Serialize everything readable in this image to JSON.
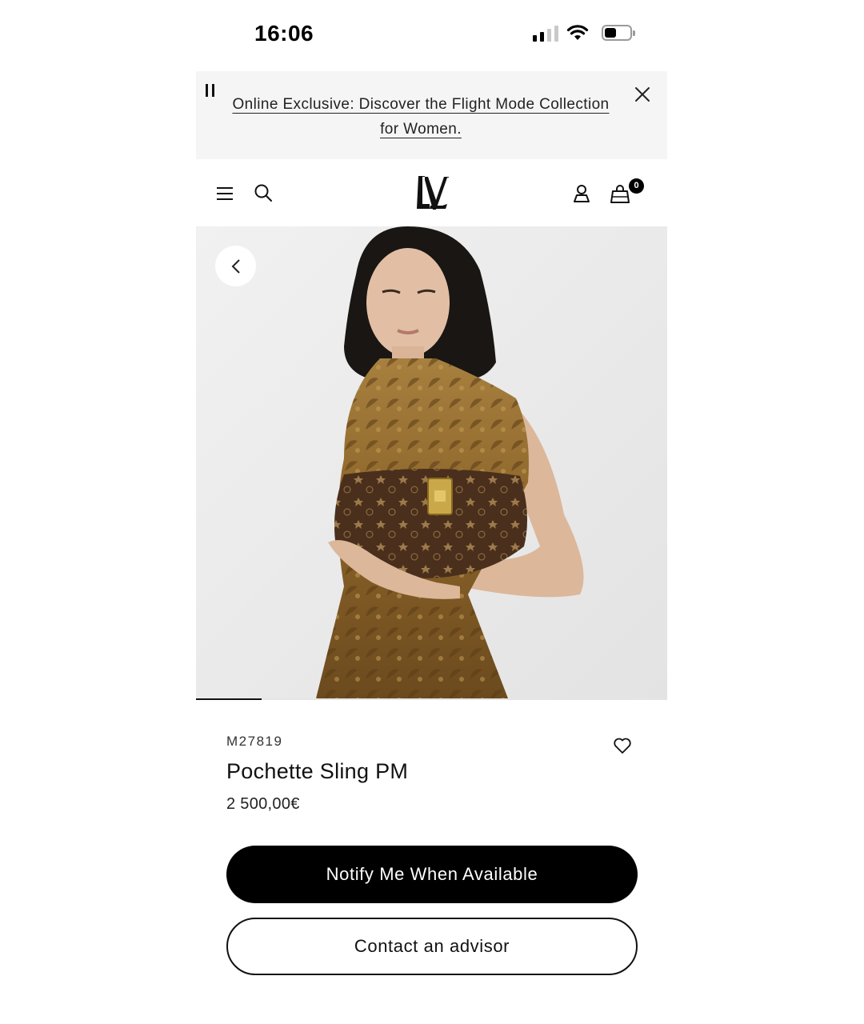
{
  "status_bar": {
    "time": "16:06"
  },
  "promo": {
    "text": "Online Exclusive: Discover the Flight Mode Collection for Women."
  },
  "nav": {
    "bag_count": "0",
    "icons": [
      "menu-icon",
      "search-icon",
      "lv-logo",
      "account-icon",
      "shopping-bag-icon"
    ]
  },
  "gallery": {
    "progress": 0.14
  },
  "product": {
    "sku": "M27819",
    "name": "Pochette Sling PM",
    "price": "2 500,00€"
  },
  "actions": {
    "notify_label": "Notify Me When Available",
    "advisor_label": "Contact an advisor"
  },
  "colors": {
    "primary": "#000000",
    "promo_bg": "#f5f5f5",
    "hero_bg": "#ececec"
  }
}
